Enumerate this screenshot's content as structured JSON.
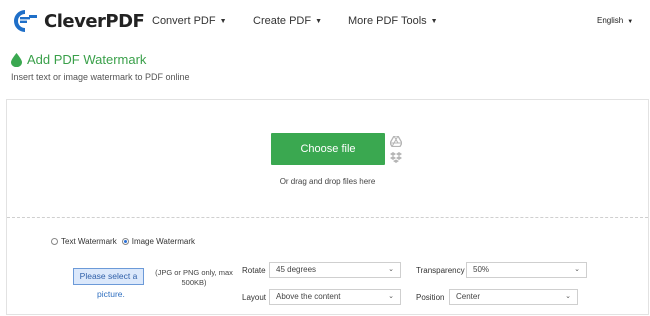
{
  "brand": {
    "name": "CleverPDF",
    "color": "#1f6fc8"
  },
  "nav": {
    "items": [
      {
        "label": "Convert PDF",
        "icon": "chevron-down-icon"
      },
      {
        "label": "Create PDF",
        "icon": "chevron-down-icon"
      },
      {
        "label": "More PDF Tools",
        "icon": "chevron-down-icon"
      }
    ],
    "language": "English"
  },
  "page": {
    "title": "Add PDF Watermark",
    "subtitle": "Insert text or image watermark to PDF online",
    "accent": "#3aa850"
  },
  "upload": {
    "choose_label": "Choose file",
    "drop_hint": "Or drag and drop files here",
    "cloud_icons": [
      "google-drive-icon",
      "dropbox-icon"
    ]
  },
  "watermark": {
    "type_options": [
      {
        "label": "Text Watermark",
        "checked": false
      },
      {
        "label": "Image Watermark",
        "checked": true
      }
    ],
    "select_picture_label": "Please select a",
    "select_picture_link": "picture.",
    "format_note": "(JPG or PNG only, max 500KB)",
    "rotate": {
      "label": "Rotate",
      "value": "45 degrees"
    },
    "transparency": {
      "label": "Transparency",
      "value": "50%"
    },
    "layout": {
      "label": "Layout",
      "value": "Above the content"
    },
    "position": {
      "label": "Position",
      "value": "Center"
    }
  }
}
